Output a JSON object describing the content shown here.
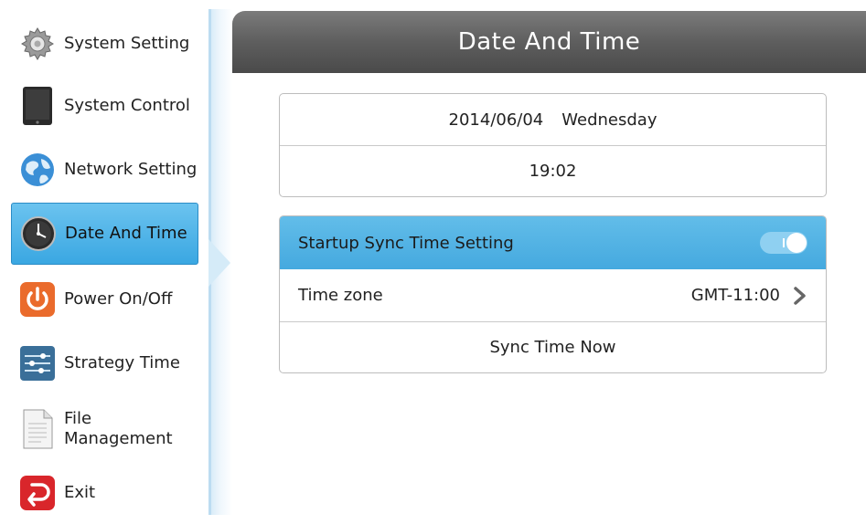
{
  "sidebar": {
    "items": [
      {
        "label": "System Setting",
        "icon": "gear-icon"
      },
      {
        "label": "System Control",
        "icon": "tablet-icon"
      },
      {
        "label": "Network Setting",
        "icon": "globe-icon"
      },
      {
        "label": "Date And Time",
        "icon": "clock-icon",
        "active": true
      },
      {
        "label": "Power On/Off",
        "icon": "power-icon"
      },
      {
        "label": "Strategy Time",
        "icon": "sliders-icon"
      },
      {
        "label_line1": "File",
        "label_line2": "Management",
        "icon": "document-icon"
      },
      {
        "label": "Exit",
        "icon": "exit-icon"
      }
    ]
  },
  "header": {
    "title": "Date And Time"
  },
  "datetime": {
    "date": "2014/06/04",
    "weekday": "Wednesday",
    "time": "19:02"
  },
  "settings": {
    "sync_label": "Startup Sync Time Setting",
    "sync_enabled": true,
    "timezone_label": "Time zone",
    "timezone_value": "GMT-11:00",
    "sync_now_label": "Sync Time Now"
  },
  "colors": {
    "accent": "#45a9df",
    "header": "#5e5e5e",
    "toggle_track": "#8fd0f1"
  }
}
